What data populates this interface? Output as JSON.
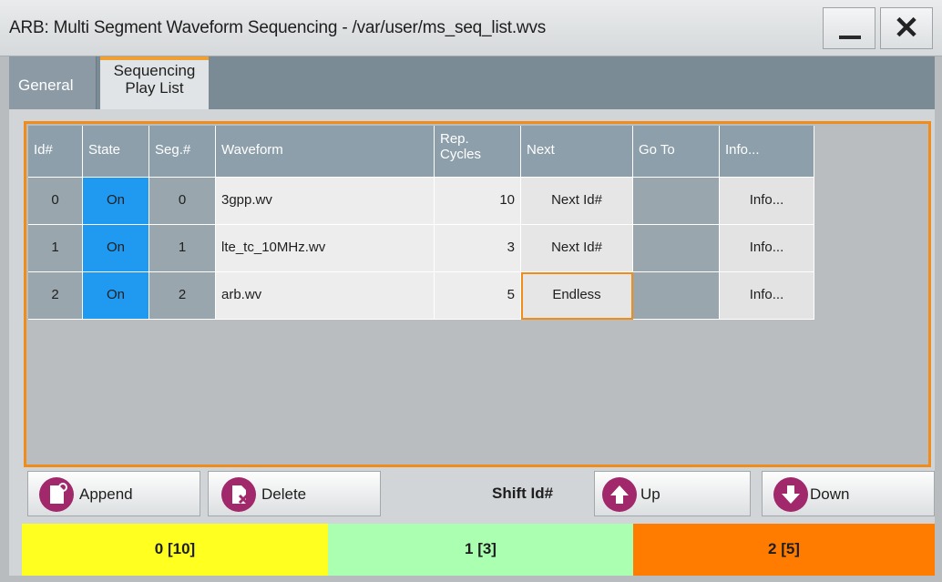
{
  "window": {
    "title": "ARB: Multi Segment Waveform Sequencing - /var/user/ms_seq_list.wvs",
    "close_glyph": "✕"
  },
  "tabs": [
    {
      "label": "General"
    },
    {
      "label": "Sequencing\nPlay List"
    }
  ],
  "table": {
    "headers": [
      "Id#",
      "State",
      "Seg.#",
      "Waveform",
      "Rep.\nCycles",
      "Next",
      "Go To",
      "Info..."
    ],
    "rows": [
      {
        "id": "0",
        "state": "On",
        "seg": "0",
        "waveform": "3gpp.wv",
        "rep": "10",
        "next": "Next Id#",
        "goto": "",
        "info": "Info..."
      },
      {
        "id": "1",
        "state": "On",
        "seg": "1",
        "waveform": "lte_tc_10MHz.wv",
        "rep": "3",
        "next": "Next Id#",
        "goto": "",
        "info": "Info..."
      },
      {
        "id": "2",
        "state": "On",
        "seg": "2",
        "waveform": "arb.wv",
        "rep": "5",
        "next": "Endless",
        "goto": "",
        "info": "Info..."
      }
    ]
  },
  "buttons": {
    "append": "Append",
    "delete": "Delete",
    "shift_label": "Shift Id#",
    "up": "Up",
    "down": "Down"
  },
  "status_bar": [
    {
      "label": "0 [10]",
      "color": "#ffff20"
    },
    {
      "label": "1 [3]",
      "color": "#aaffb0"
    },
    {
      "label": "2 [5]",
      "color": "#ff7c00"
    }
  ],
  "colors": {
    "accent": "#f08c1a",
    "state_on": "#1f9af0",
    "icon_bg": "#a0286b"
  },
  "icons": {
    "append": "append-file-icon",
    "delete": "delete-file-icon",
    "up": "arrow-up-icon",
    "down": "arrow-down-icon"
  }
}
